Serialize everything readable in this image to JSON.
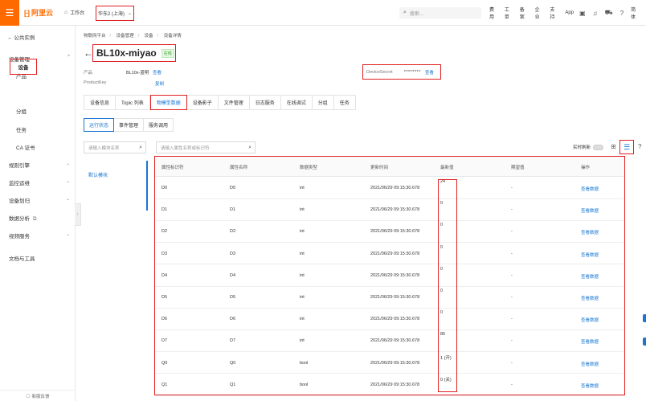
{
  "topbar": {
    "logo_text": "阿里云",
    "workbench": "工作台",
    "region": "华东2 (上海)",
    "search_placeholder": "搜索...",
    "nav": [
      "费用",
      "工单",
      "备案",
      "企业",
      "支持",
      "App"
    ],
    "lang": "简体"
  },
  "sidebar": {
    "back": "公共实例",
    "group_device_mgmt": "设备管理",
    "items": [
      "产品",
      "设备",
      "分组",
      "任务",
      "CA 证书"
    ],
    "active_item": "设备",
    "groups": [
      "规则引擎",
      "监控运维",
      "设备划归",
      "数据分析",
      "视频服务",
      "文档与工具"
    ],
    "footer": "新版反馈"
  },
  "breadcrumb": [
    "物联网平台",
    "设备管理",
    "设备",
    "设备详情"
  ],
  "device": {
    "name": "BL10x-miyao",
    "status": "在线",
    "product_label": "产品",
    "product_value": "BL10x-蓝明",
    "product_link": "查看",
    "productkey_label": "ProductKey",
    "productkey_link": "复制",
    "secret_label": "DeviceSecret",
    "secret_mask": "********",
    "secret_link": "查看"
  },
  "tabs": [
    "设备信息",
    "Topic 列表",
    "物模型数据",
    "设备影子",
    "文件管理",
    "日志服务",
    "在线调试",
    "分组",
    "任务"
  ],
  "active_tab": "物模型数据",
  "subtabs": [
    "运行状态",
    "事件管理",
    "服务调用"
  ],
  "active_subtab": "运行状态",
  "module_search_placeholder": "请输入模块名称",
  "attr_search_placeholder": "请输入属性名称或标识符",
  "realtime_label": "实时刷新",
  "module": "默认模块",
  "table": {
    "headers": [
      "属性标识符",
      "属性名称",
      "数据类型",
      "更新时间",
      "最新值",
      "期望值",
      "操作"
    ],
    "rows": [
      [
        "D0",
        "D0",
        "int",
        "2021/06/29 09:15:30.678",
        "24",
        "-",
        "查看数据"
      ],
      [
        "D1",
        "D1",
        "int",
        "2021/06/29 09:15:30.678",
        "0",
        "-",
        "查看数据"
      ],
      [
        "D2",
        "D2",
        "int",
        "2021/06/29 09:15:30.678",
        "0",
        "-",
        "查看数据"
      ],
      [
        "D3",
        "D3",
        "int",
        "2021/06/29 09:15:30.678",
        "0",
        "-",
        "查看数据"
      ],
      [
        "D4",
        "D4",
        "int",
        "2021/06/29 09:15:30.678",
        "0",
        "-",
        "查看数据"
      ],
      [
        "D5",
        "D5",
        "int",
        "2021/06/29 09:15:30.678",
        "0",
        "-",
        "查看数据"
      ],
      [
        "D6",
        "D6",
        "int",
        "2021/06/29 09:15:30.678",
        "0",
        "-",
        "查看数据"
      ],
      [
        "D7",
        "D7",
        "int",
        "2021/06/29 09:15:30.678",
        "85",
        "-",
        "查看数据"
      ],
      [
        "Q0",
        "Q0",
        "bool",
        "2021/06/29 09:15:30.678",
        "1 (开)",
        "-",
        "查看数据"
      ],
      [
        "Q1",
        "Q1",
        "bool",
        "2021/06/29 09:15:30.678",
        "0 (关)",
        "-",
        "查看数据"
      ]
    ]
  }
}
